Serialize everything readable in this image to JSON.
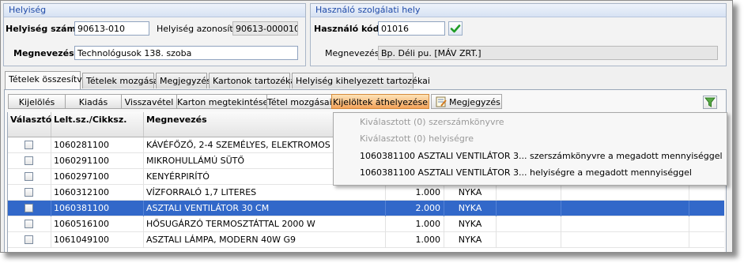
{
  "helyiseg_group": {
    "title": "Helyiség",
    "szam_label": "Helyiség szám:",
    "szam_value": "90613-010",
    "azonosito_label": "Helyiség azonosító:",
    "azonosito_value": "90613-000010",
    "megnevezes_label": "Megnevezés:",
    "megnevezes_value": "Technológusok   138. szoba"
  },
  "hasznalo_group": {
    "title": "Használó szolgálati hely",
    "kod_label": "Használó kód:",
    "kod_value": "01016",
    "megnevezes_label": "Megnevezés:",
    "megnevezes_value": "Bp. Déli pu. [MÁV ZRT.]"
  },
  "tabs": [
    {
      "label": "Tételek összesítve"
    },
    {
      "label": "Tételek mozgásai"
    },
    {
      "label": "Megjegyzés"
    },
    {
      "label": "Kartonok tartozékai"
    },
    {
      "label": "Helyiség kihelyezett tartozékai"
    }
  ],
  "toolbar": [
    {
      "label": "Kijelölés"
    },
    {
      "label": "Kiadás"
    },
    {
      "label": "Visszavétel"
    },
    {
      "label": "Karton megtekintése"
    },
    {
      "label": "Tétel mozgásai"
    },
    {
      "label": "Kijelöltek áthelyezése"
    },
    {
      "label": "Megjegyzés"
    }
  ],
  "grid": {
    "headers": [
      "Választó",
      "Lelt.sz./Cikksz.",
      "Megnevezés"
    ],
    "rows": [
      {
        "code": "1060281100",
        "name": "KÁVÉFŐZŐ, 2-4 SZEMÉLYES, ELEKTROMOS",
        "qty": "",
        "unit": ""
      },
      {
        "code": "1060291100",
        "name": "MIKROHULLÁMÚ SÜTŐ",
        "qty": "",
        "unit": ""
      },
      {
        "code": "1060297100",
        "name": "KENYÉRPIRÍTÓ",
        "qty": "",
        "unit": ""
      },
      {
        "code": "1060312100",
        "name": "VÍZFORRALÓ 1,7 LITERES",
        "qty": "1.000",
        "unit": "NYKA"
      },
      {
        "code": "1060381100",
        "name": "ASZTALI VENTILÁTOR 30 CM",
        "qty": "2.000",
        "unit": "NYKA"
      },
      {
        "code": "1060516100",
        "name": "HŐSUGÁRZÓ TERMOSZTÁTTAL 2000 W",
        "qty": "1.000",
        "unit": "NYKA"
      },
      {
        "code": "1061049100",
        "name": "ASZTALI LÁMPA, MODERN 40W G9",
        "qty": "1.000",
        "unit": "NYKA"
      }
    ]
  },
  "context_menu": [
    {
      "label": "Kiválasztott (0) szerszámkönyvre",
      "disabled": true
    },
    {
      "label": "Kiválasztott (0) helyiségre",
      "disabled": true
    },
    {
      "label": "1060381100 ASZTALI VENTILÁTOR 3... szerszámkönyvre a megadott mennyiséggel",
      "disabled": false
    },
    {
      "label": "1060381100 ASZTALI VENTILÁTOR 3... helyiségre a megadott mennyiséggel",
      "disabled": false
    }
  ],
  "icons": {
    "confirm": "green-check-icon",
    "note": "note-icon",
    "filter": "filter-funnel-icon"
  }
}
